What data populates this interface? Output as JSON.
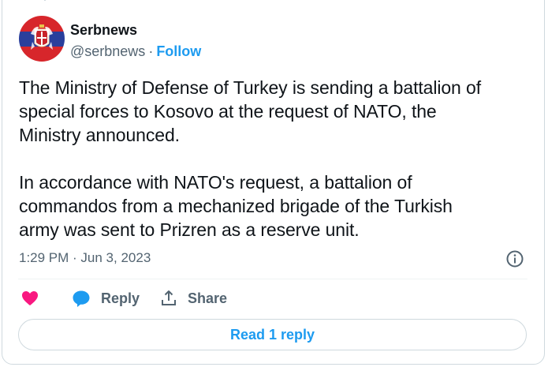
{
  "account": {
    "name": "Serbnews",
    "handle": "@serbnews",
    "separator": "·",
    "follow_label": "Follow"
  },
  "tweet": {
    "text": "The Ministry of Defense of Turkey is sending a battalion of\nspecial forces to Kosovo at the request of NATO, the\nMinistry announced.\n\nIn accordance with NATO's request, a battalion of\ncommandos from a mechanized brigade of the Turkish\narmy was sent to Prizren as a reserve unit.",
    "timestamp": "1:29 PM · Jun 3, 2023"
  },
  "actions": {
    "like_icon": "heart-icon",
    "reply_label": "Reply",
    "share_label": "Share"
  },
  "read_replies_label": "Read 1 reply",
  "colors": {
    "accent": "#1d9bf0",
    "like": "#f91880",
    "muted": "#536471",
    "avatar_red": "#d7262b",
    "avatar_blue": "#2a3f9c"
  }
}
